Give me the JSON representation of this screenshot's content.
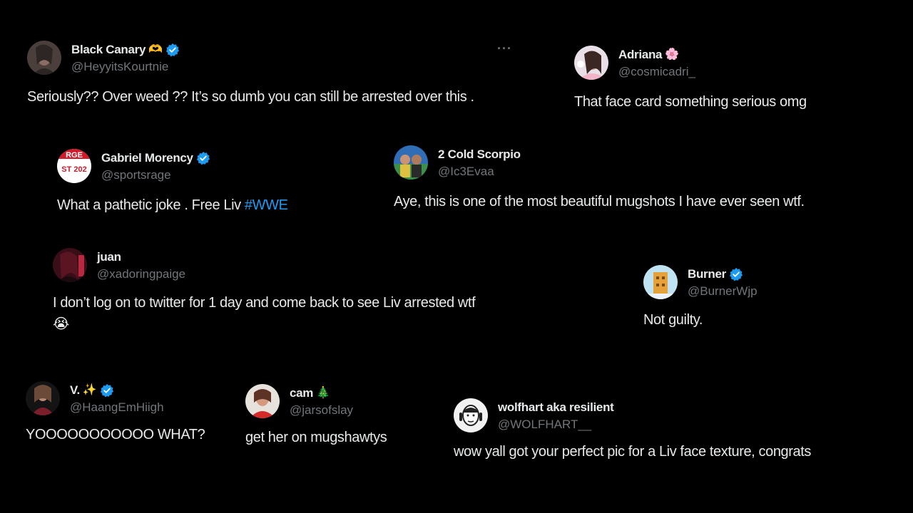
{
  "colors": {
    "background": "#000000",
    "text_primary": "#e7e9ea",
    "text_secondary": "#71767b",
    "verified_blue": "#1d9bf0",
    "link_blue": "#1d9bf0"
  },
  "more_label": "···",
  "tweets": [
    {
      "display_name": "Black Canary",
      "name_emoji": "🫶",
      "verified": true,
      "handle": "@HeyyitsKourtnie",
      "text": "Seriously?? Over weed ?? It’s so dumb you can still be arrested over this ."
    },
    {
      "display_name": "Adriana",
      "name_emoji": "🌸",
      "verified": false,
      "handle": "@cosmicadri_",
      "text": "That face card something serious omg"
    },
    {
      "display_name": "Gabriel Morency",
      "verified": true,
      "handle": "@sportsrage",
      "text": "What a pathetic joke . Free Liv ",
      "hashtag": "#WWE"
    },
    {
      "display_name": "2 Cold Scorpio",
      "verified": false,
      "handle": "@Ic3Evaa",
      "text": "Aye, this is one of the most beautiful mugshots I have ever seen wtf."
    },
    {
      "display_name": "juan",
      "verified": false,
      "handle": "@xadoringpaige",
      "text": "I don’t log on to twitter for 1 day and come back to see Liv arrested wtf",
      "text_line2": "😭"
    },
    {
      "display_name": "Burner",
      "verified": true,
      "handle": "@BurnerWjp",
      "text": "Not guilty."
    },
    {
      "display_name": "V.",
      "name_emoji": "✨",
      "verified": true,
      "handle": "@HaangEmHiigh",
      "text": "YOOOOOOOOOOO WHAT?"
    },
    {
      "display_name": "cam",
      "name_emoji": "🎄",
      "verified": false,
      "handle": "@jarsofslay",
      "text": "get her on mugshawtys"
    },
    {
      "display_name": "wolfhart aka resilient",
      "verified": false,
      "handle": "@WOLFHART__",
      "text": "wow yall got your perfect pic for a Liv face texture, congrats"
    }
  ]
}
